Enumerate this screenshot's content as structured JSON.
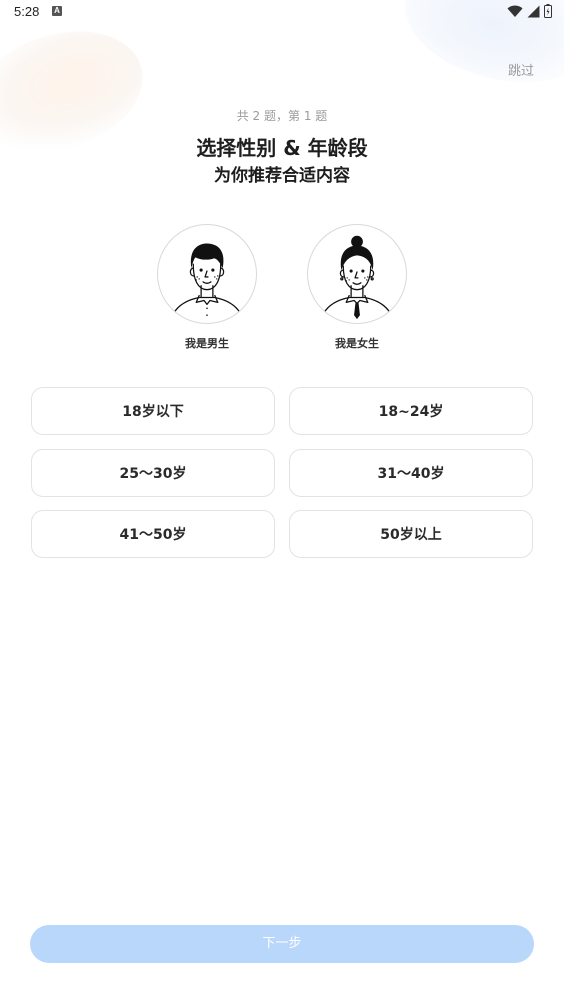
{
  "status_bar": {
    "time": "5:28",
    "notification_icon": "a-badge-icon",
    "icons": [
      "wifi-icon",
      "signal-icon",
      "battery-icon"
    ]
  },
  "header": {
    "skip_label": "跳过"
  },
  "question": {
    "progress": "共 2 题，第 1 题",
    "title": "选择性别 & 年龄段",
    "subtitle": "为你推荐合适内容"
  },
  "gender_options": [
    {
      "label": "我是男生",
      "icon": "male-avatar-icon"
    },
    {
      "label": "我是女生",
      "icon": "female-avatar-icon"
    }
  ],
  "age_options": [
    {
      "label": "18岁以下"
    },
    {
      "label": "18~24岁"
    },
    {
      "label": "25～30岁"
    },
    {
      "label": "31～40岁"
    },
    {
      "label": "41～50岁"
    },
    {
      "label": "50岁以上"
    }
  ],
  "footer": {
    "next_label": "下一步"
  },
  "colors": {
    "accent_disabled": "#b9d6fb",
    "text_primary": "#1e1e1e",
    "text_muted": "#9b9b9b",
    "border": "#e3e3e3"
  }
}
